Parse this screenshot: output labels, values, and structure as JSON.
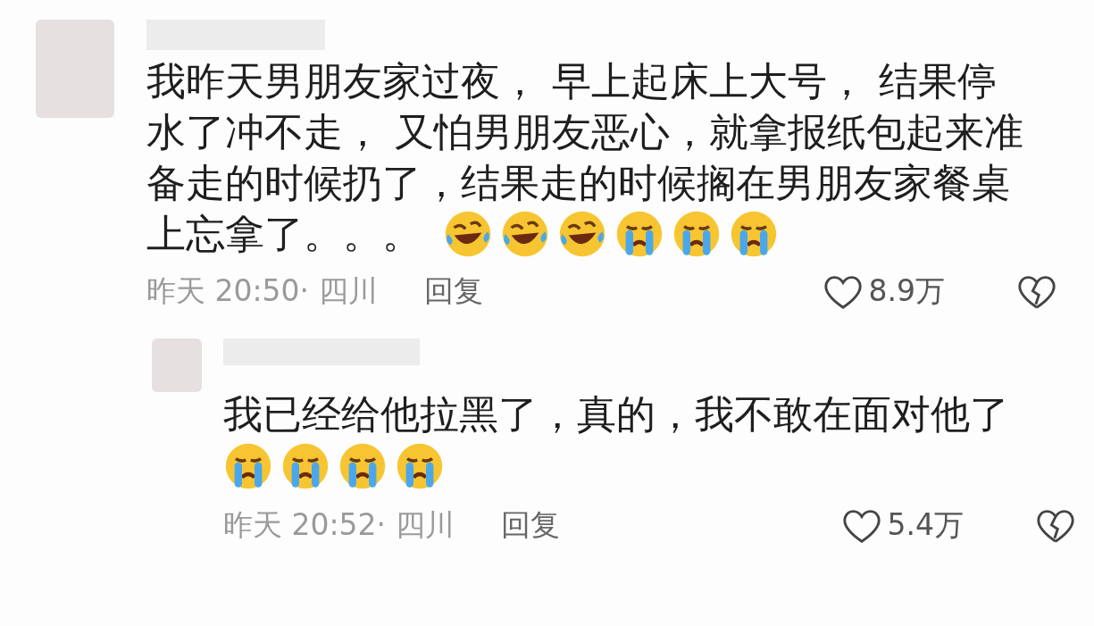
{
  "comments": [
    {
      "lines": [
        "我昨天男朋友家过夜， 早上起床上大号， 结果停",
        "水了冲不走， 又怕男朋友恶心，就拿报纸包起来准",
        "备走的时候扔了，结果走的时候搁在男朋友家餐桌",
        "上忘拿了。。。"
      ],
      "emojis": [
        {
          "kind": "laugh"
        },
        {
          "kind": "laugh"
        },
        {
          "kind": "laugh"
        },
        {
          "kind": "cry"
        },
        {
          "kind": "cry"
        },
        {
          "kind": "cry"
        }
      ],
      "time": "昨天 20:50· 四川",
      "reply": "回复",
      "likes": "8.9万",
      "replies": [
        {
          "lines": [
            "我已经给他拉黑了，真的，我不敢在面对他了"
          ],
          "emojis": [
            {
              "kind": "cry"
            },
            {
              "kind": "cry"
            },
            {
              "kind": "cry"
            },
            {
              "kind": "cry"
            }
          ],
          "time": "昨天 20:52· 四川",
          "reply": "回复",
          "likes": "5.4万"
        }
      ]
    }
  ]
}
